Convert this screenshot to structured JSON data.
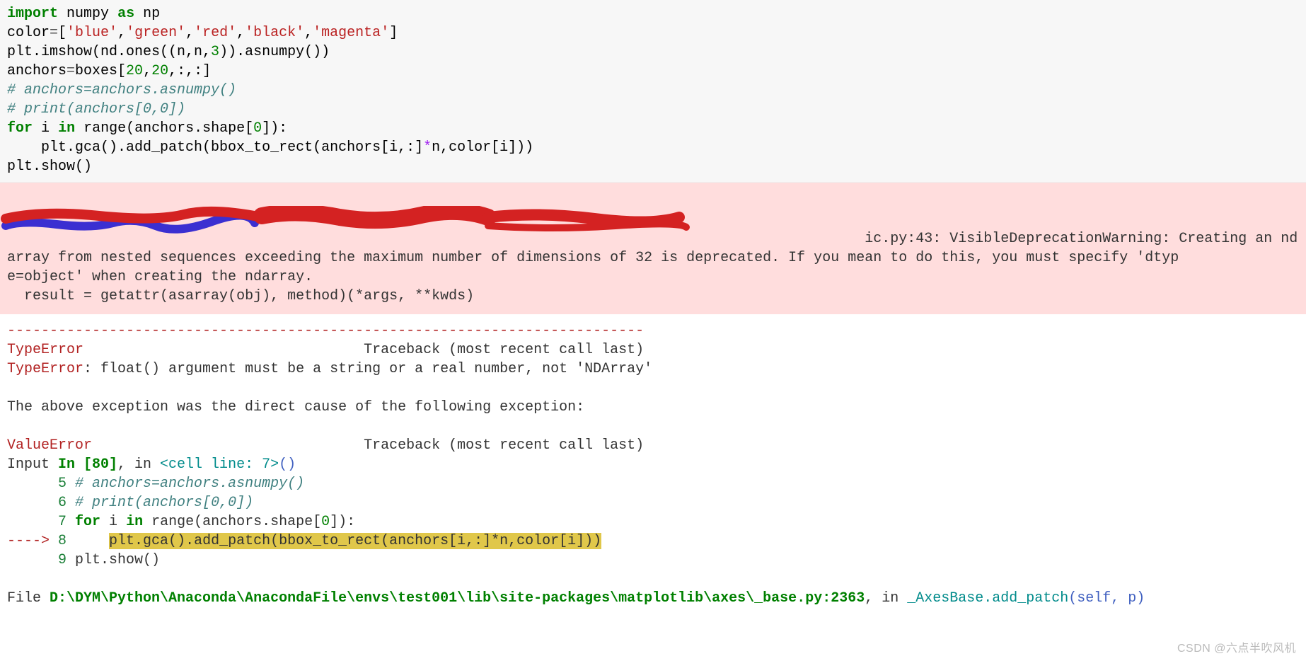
{
  "code": {
    "l1": {
      "kw1": "import",
      "sp": " ",
      "nm": "numpy",
      "sp2": " ",
      "kw2": "as",
      "sp3": " ",
      "alias": "np"
    },
    "l2": {
      "a": "color",
      "eq": "=",
      "lb": "[",
      "s1": "'blue'",
      "c1": ",",
      "s2": "'green'",
      "c2": ",",
      "s3": "'red'",
      "c3": ",",
      "s4": "'black'",
      "c4": ",",
      "s5": "'magenta'",
      "rb": "]"
    },
    "l3": {
      "p1": "plt.imshow(nd.ones((n,n,",
      "n3": "3",
      "p2": ")).asnumpy())"
    },
    "l4": {
      "a": "anchors",
      "eq": "=",
      "b": "boxes[",
      "n1": "20",
      "c1": ",",
      "n2": "20",
      "rest": ",:,:]"
    },
    "l5": "# anchors=anchors.asnumpy()",
    "l6": "# print(anchors[0,0])",
    "l7": {
      "kw1": "for",
      "sp": " ",
      "i": "i",
      "sp2": " ",
      "kw2": "in",
      "sp3": " ",
      "call": "range(anchors.shape[",
      "n0": "0",
      "p2": "]):"
    },
    "l8": {
      "indent": "    ",
      "a": "plt.gca().add_patch(bbox_to_rect(anchors[i,:]",
      "star": "*",
      "b": "n,color[i]))"
    },
    "l9": "plt.show()"
  },
  "stderr": {
    "line1_suffix": "ic.py:43: VisibleDeprecationWarning: Creating an nd",
    "line2": "array from nested sequences exceeding the maximum number of dimensions of 32 is deprecated. If you mean to do this, you must specify 'dtyp",
    "line3": "e=object' when creating the ndarray.",
    "line4": "  result = getattr(asarray(obj), method)(*args, **kwds)"
  },
  "traceback": {
    "dashes": "---------------------------------------------------------------------------",
    "tErr": "TypeError",
    "tTrace": "Traceback (most recent call last)",
    "tMsg": ": float() argument must be a string or a real number, not 'NDArray'",
    "above": "The above exception was the direct cause of the following exception:",
    "vErr": "ValueError",
    "vTrace": "Traceback (most recent call last)",
    "input1": "Input ",
    "inCell": "In [80]",
    "inRest": ", in ",
    "cellLine": "<cell line: 7>",
    "callParen": "()",
    "l5n": "5",
    "l5t": " # anchors=anchors.asnumpy()",
    "l6n": "6",
    "l6t": " # print(anchors[0,0])",
    "l7n": "7",
    "l7a": " for",
    "l7b": " i ",
    "l7c": "in",
    "l7d": " range(anchors.shape[",
    "l7z": "0",
    "l7e": "]):",
    "arrow": "----> ",
    "l8n": "8",
    "l8pad": "     ",
    "l8t": "plt.gca().add_patch(bbox_to_rect(anchors[i,:]*n,color[i]))",
    "l9n": "9",
    "l9t": " plt.show()",
    "filePrefix": "File ",
    "filePath": "D:\\DYM\\Python\\Anaconda\\AnacondaFile\\envs\\test001\\lib\\site-packages\\matplotlib\\axes\\_base.py:2363",
    "fileIn": ", in ",
    "fileFunc": "_AxesBase.add_patch",
    "fileArgs": "(self, p)"
  },
  "watermark": "CSDN @六点半吹风机"
}
